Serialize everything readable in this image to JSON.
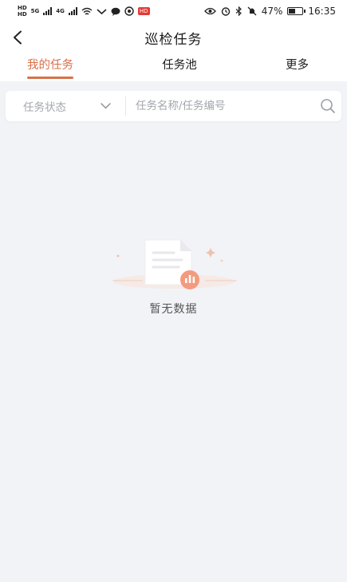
{
  "status_bar": {
    "network_a": "5G",
    "network_b": "4G",
    "notification_badge": "HD",
    "battery_percent": "47%",
    "time": "16:35"
  },
  "header": {
    "title": "巡检任务"
  },
  "tabs": [
    {
      "label": "我的任务",
      "active": true
    },
    {
      "label": "任务池",
      "active": false
    },
    {
      "label": "更多",
      "active": false
    }
  ],
  "filter": {
    "status_label": "任务状态",
    "search_placeholder": "任务名称/任务编号"
  },
  "empty_state": {
    "text": "暂无数据"
  },
  "colors": {
    "accent": "#d9704a",
    "background": "#f2f3f7"
  }
}
